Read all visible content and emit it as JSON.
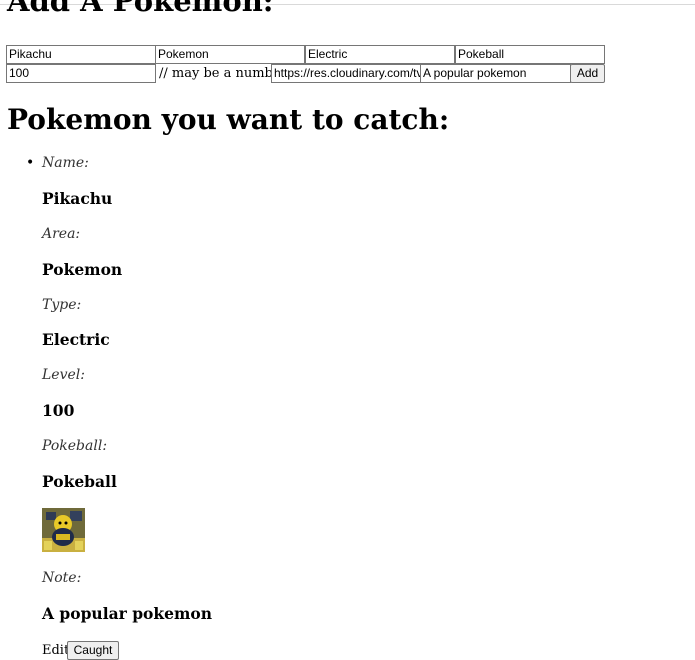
{
  "add_form": {
    "title": "Add A Pokemon:",
    "name_value": "Pikachu",
    "area_value": "Pokemon",
    "type_value": "Electric",
    "pokeball_value": "Pokeball",
    "level_value": "100",
    "level_hint": "// may be a number",
    "image_url_value": "https://res.cloudinary.com/tv",
    "note_value": "A popular pokemon",
    "add_button_label": "Add"
  },
  "list": {
    "title": "Pokemon you want to catch:",
    "items": [
      {
        "name_label": "Name:",
        "name": "Pikachu",
        "area_label": "Area:",
        "area": "Pokemon",
        "type_label": "Type:",
        "type": "Electric",
        "level_label": "Level:",
        "level": "100",
        "pokeball_label": "Pokeball:",
        "pokeball": "Pokeball",
        "note_label": "Note:",
        "note": "A popular pokemon",
        "edit_label": "Edit",
        "caught_label": "Caught"
      }
    ]
  }
}
